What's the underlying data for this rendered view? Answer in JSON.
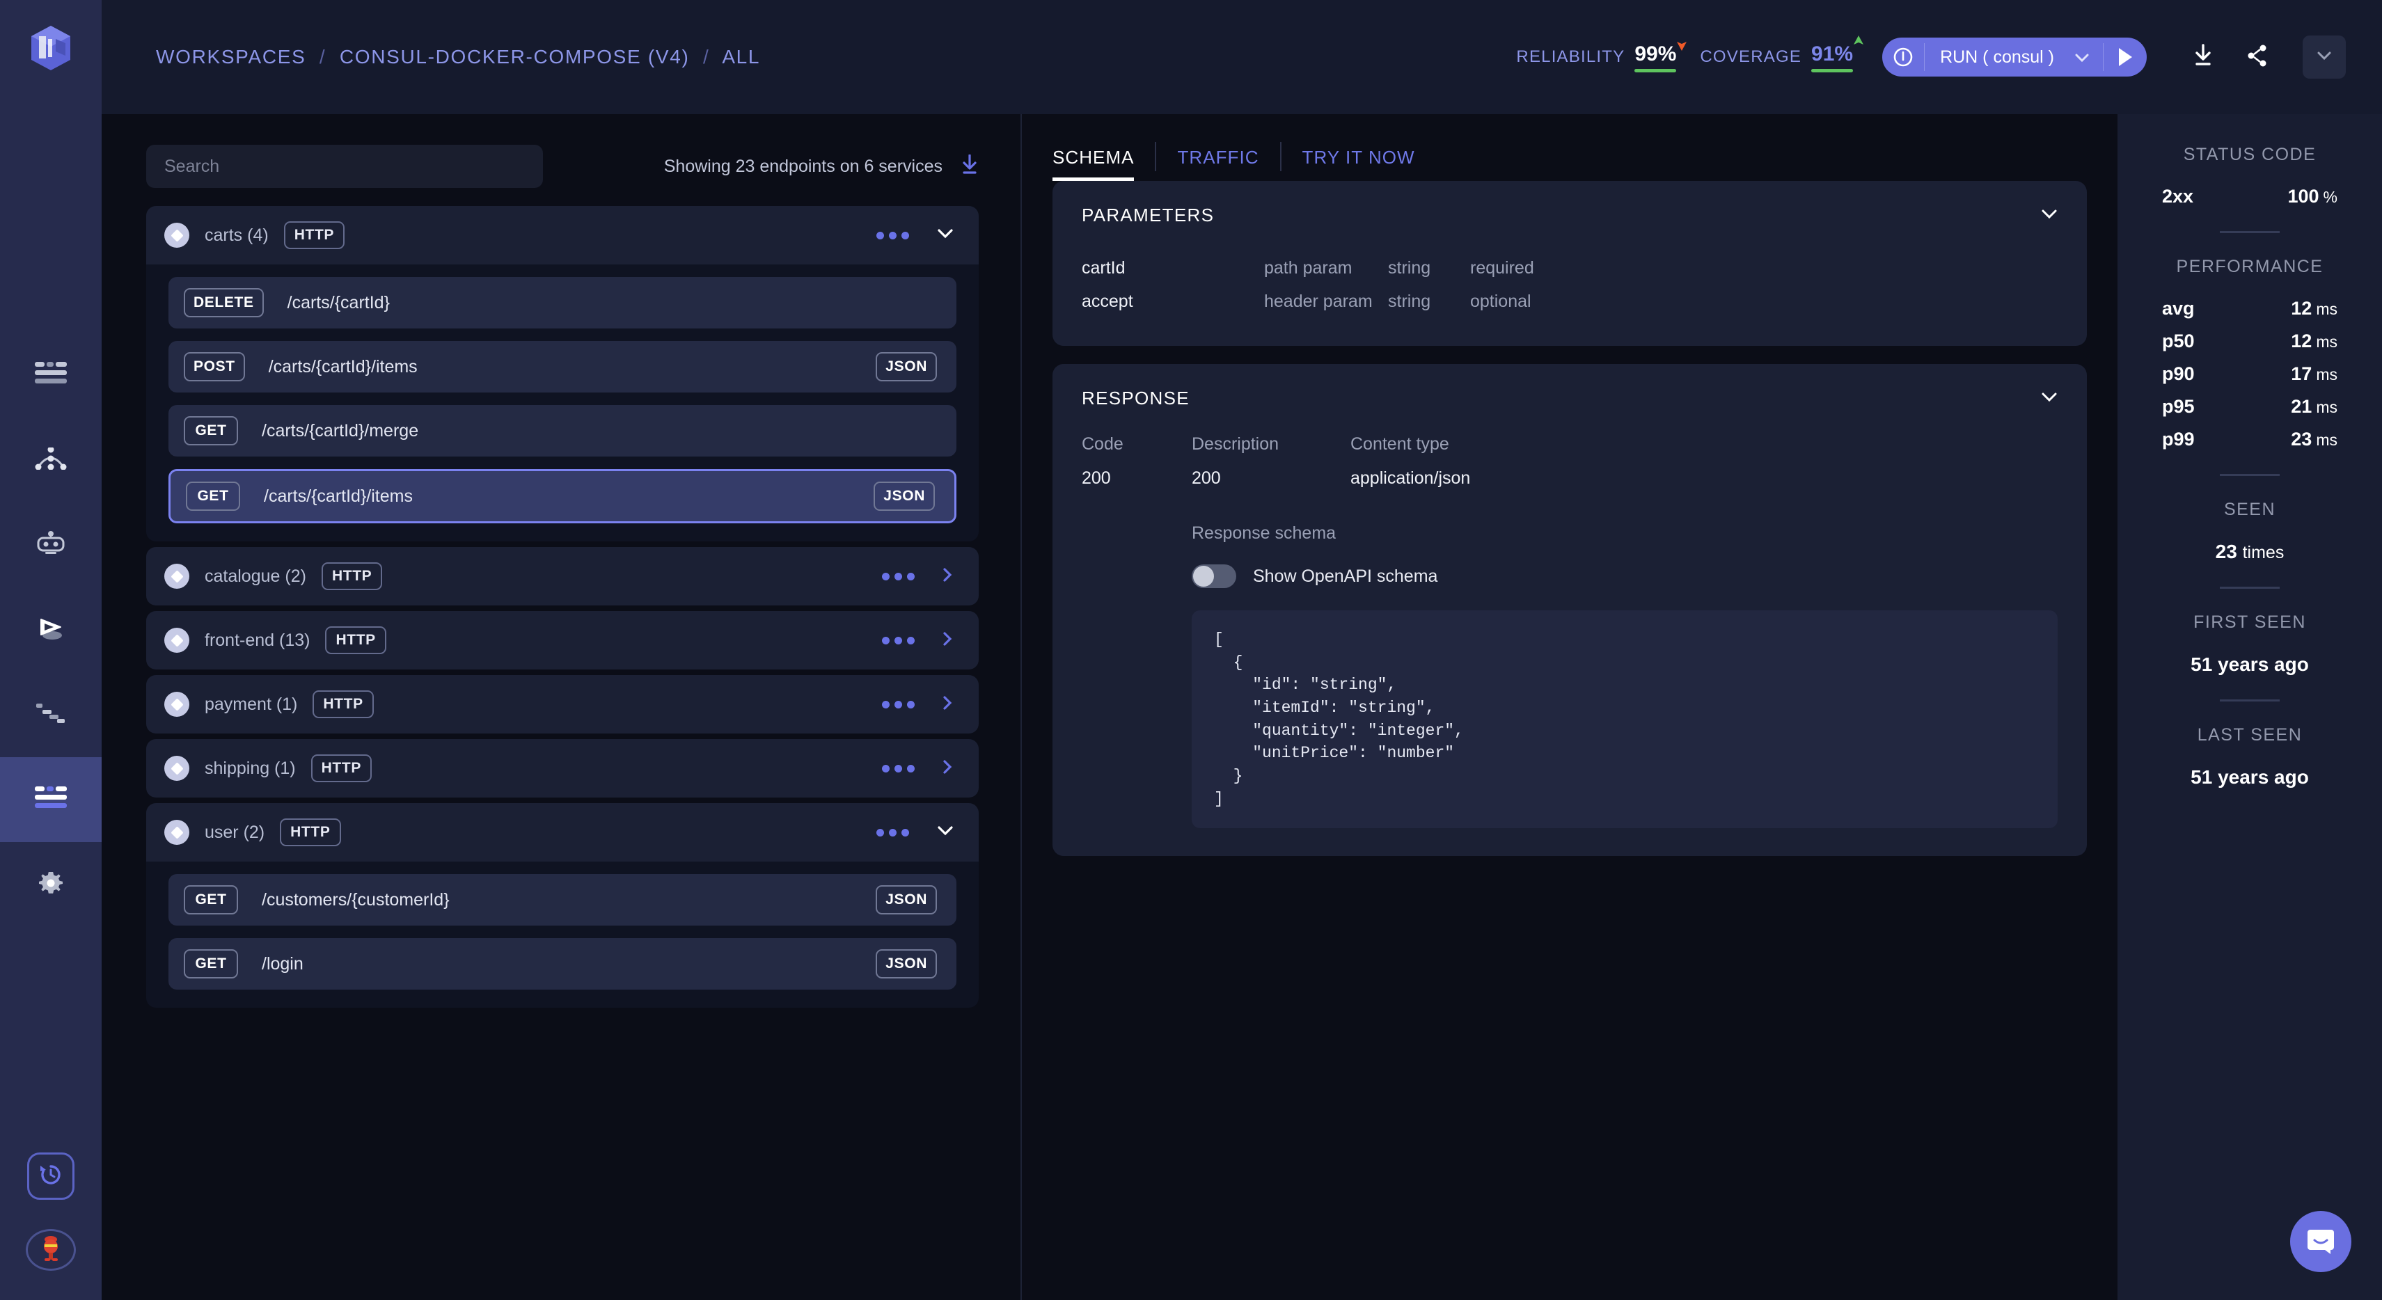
{
  "rail": {
    "logo_icon": "meshdynamics-logo-icon",
    "items": [
      {
        "name": "list-view",
        "icon": "list-icon",
        "active": false
      },
      {
        "name": "topology",
        "icon": "topology-icon",
        "active": false
      },
      {
        "name": "mocks",
        "icon": "robot-icon",
        "active": false
      },
      {
        "name": "replay",
        "icon": "play-flag-icon",
        "active": false
      },
      {
        "name": "diffs",
        "icon": "steps-icon",
        "active": false
      },
      {
        "name": "api-catalog",
        "icon": "list-icon",
        "active": true
      },
      {
        "name": "settings",
        "icon": "gear-icon",
        "active": false
      }
    ],
    "bottom": [
      {
        "name": "history",
        "icon": "history-clock-icon"
      },
      {
        "name": "avatar",
        "icon": "avatar-icon"
      }
    ]
  },
  "topbar": {
    "breadcrumb": [
      "WORKSPACES",
      "CONSUL-DOCKER-COMPOSE (V4)",
      "ALL"
    ],
    "separator": "/",
    "metrics": [
      {
        "label": "RELIABILITY",
        "value": "99%",
        "trend": "down",
        "trend_color": "#f05a28",
        "value_color": "#ffffff",
        "bar_color": "#5ec45e"
      },
      {
        "label": "COVERAGE",
        "value": "91%",
        "trend": "up",
        "trend_color": "#5ec45e",
        "value_color": "#7d87ea",
        "bar_color": "#5ec45e"
      }
    ],
    "run_button": {
      "label": "RUN ( consul )",
      "icon": "clock-icon",
      "caret": "chevron-down-icon",
      "play": "play-icon",
      "color": "#6a6fe0"
    },
    "actions": [
      {
        "name": "download-button",
        "icon": "download-icon"
      },
      {
        "name": "share-button",
        "icon": "share-icon"
      }
    ],
    "more_caret": "chevron-down-icon"
  },
  "search": {
    "placeholder": "Search",
    "value": "",
    "icon": "search-icon"
  },
  "list_header": {
    "showing_text": "Showing 23 endpoints on 6 services",
    "download_icon": "download-icon"
  },
  "services": [
    {
      "name": "carts (4)",
      "protocol": "HTTP",
      "expanded": true,
      "menu_icon": "more-dots-icon",
      "caret_icon": "chevron-down-icon",
      "endpoints": [
        {
          "verb": "DELETE",
          "path": "/carts/{cartId}",
          "format": "",
          "selected": false
        },
        {
          "verb": "POST",
          "path": "/carts/{cartId}/items",
          "format": "JSON",
          "selected": false
        },
        {
          "verb": "GET",
          "path": "/carts/{cartId}/merge",
          "format": "",
          "selected": false
        },
        {
          "verb": "GET",
          "path": "/carts/{cartId}/items",
          "format": "JSON",
          "selected": true
        }
      ]
    },
    {
      "name": "catalogue (2)",
      "protocol": "HTTP",
      "expanded": false,
      "menu_icon": "more-dots-icon",
      "caret_icon": "chevron-right-icon",
      "endpoints": []
    },
    {
      "name": "front-end (13)",
      "protocol": "HTTP",
      "expanded": false,
      "menu_icon": "more-dots-icon",
      "caret_icon": "chevron-right-icon",
      "endpoints": []
    },
    {
      "name": "payment (1)",
      "protocol": "HTTP",
      "expanded": false,
      "menu_icon": "more-dots-icon",
      "caret_icon": "chevron-right-icon",
      "endpoints": []
    },
    {
      "name": "shipping (1)",
      "protocol": "HTTP",
      "expanded": false,
      "menu_icon": "more-dots-icon",
      "caret_icon": "chevron-right-icon",
      "endpoints": []
    },
    {
      "name": "user (2)",
      "protocol": "HTTP",
      "expanded": true,
      "menu_icon": "more-dots-icon",
      "caret_icon": "chevron-down-icon",
      "endpoints": [
        {
          "verb": "GET",
          "path": "/customers/{customerId}",
          "format": "JSON",
          "selected": false
        },
        {
          "verb": "GET",
          "path": "/login",
          "format": "JSON",
          "selected": false
        }
      ]
    }
  ],
  "tabs": [
    {
      "label": "SCHEMA",
      "active": true
    },
    {
      "label": "TRAFFIC",
      "active": false
    },
    {
      "label": "TRY IT NOW",
      "active": false
    }
  ],
  "parameters_card": {
    "title": "PARAMETERS",
    "caret_icon": "chevron-down-icon",
    "rows": [
      {
        "name": "cartId",
        "in": "path param",
        "type": "string",
        "required": "required"
      },
      {
        "name": "accept",
        "in": "header param",
        "type": "string",
        "required": "optional"
      }
    ]
  },
  "response_card": {
    "title": "RESPONSE",
    "caret_icon": "chevron-down-icon",
    "headers": [
      "Code",
      "Description",
      "Content type"
    ],
    "values": [
      "200",
      "200",
      "application/json"
    ],
    "schema_label": "Response schema",
    "toggle": {
      "label": "Show OpenAPI schema",
      "on": false
    },
    "code": "[\n  {\n    \"id\": \"string\",\n    \"itemId\": \"string\",\n    \"quantity\": \"integer\",\n    \"unitPrice\": \"number\"\n  }\n]"
  },
  "stats": {
    "status_code": {
      "title": "STATUS CODE",
      "rows": [
        {
          "key": "2xx",
          "value": "100",
          "unit": "%"
        }
      ]
    },
    "performance": {
      "title": "PERFORMANCE",
      "rows": [
        {
          "key": "avg",
          "value": "12",
          "unit": "ms"
        },
        {
          "key": "p50",
          "value": "12",
          "unit": "ms"
        },
        {
          "key": "p90",
          "value": "17",
          "unit": "ms"
        },
        {
          "key": "p95",
          "value": "21",
          "unit": "ms"
        },
        {
          "key": "p99",
          "value": "23",
          "unit": "ms"
        }
      ]
    },
    "seen": {
      "title": "SEEN",
      "value": "23",
      "unit": "times"
    },
    "first_seen": {
      "title": "FIRST SEEN",
      "value": "51 years ago"
    },
    "last_seen": {
      "title": "LAST SEEN",
      "value": "51 years ago"
    }
  },
  "intercom": {
    "icon": "chat-bubble-icon",
    "color": "#6a6fe0"
  }
}
